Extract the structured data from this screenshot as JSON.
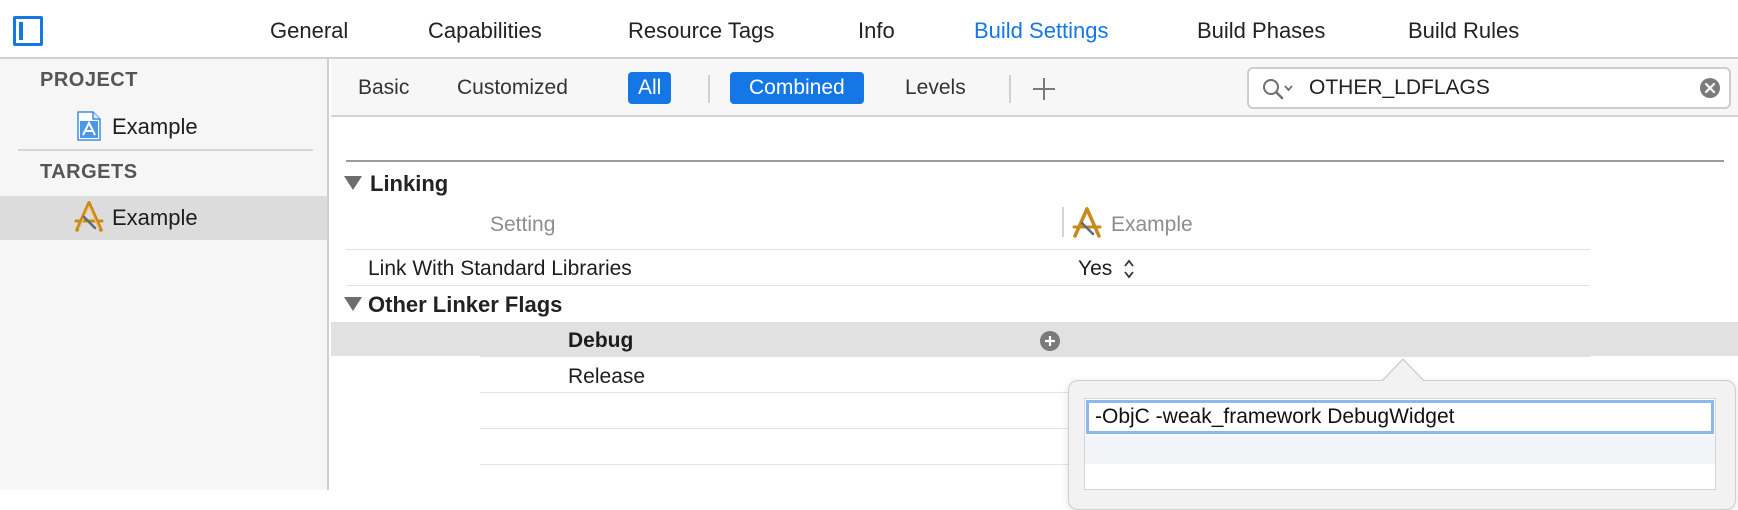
{
  "top_tabs": {
    "sidebar_toggle_icon": "sidebar-toggle-icon",
    "items": [
      {
        "label": "General"
      },
      {
        "label": "Capabilities"
      },
      {
        "label": "Resource Tags"
      },
      {
        "label": "Info"
      },
      {
        "label": "Build Settings",
        "active": true
      },
      {
        "label": "Build Phases"
      },
      {
        "label": "Build Rules"
      }
    ]
  },
  "navigator": {
    "project_header": "PROJECT",
    "project_item": "Example",
    "targets_header": "TARGETS",
    "target_item": "Example",
    "target_selected": true
  },
  "filter_bar": {
    "scope": [
      {
        "label": "Basic"
      },
      {
        "label": "Customized"
      },
      {
        "label": "All",
        "selected": true
      }
    ],
    "view": [
      {
        "label": "Combined",
        "selected": true
      },
      {
        "label": "Levels"
      }
    ],
    "add_icon": "plus-icon",
    "search": {
      "value": "OTHER_LDFLAGS",
      "icon": "search-icon",
      "clear_icon": "clear-icon"
    }
  },
  "settings": {
    "group_linking": "Linking",
    "column_setting": "Setting",
    "column_target": "Example",
    "rows": [
      {
        "name": "Link With Standard Libraries",
        "value": "Yes"
      }
    ],
    "group_other_linker_flags": "Other Linker Flags",
    "configs": [
      {
        "name": "Debug",
        "selected": true
      },
      {
        "name": "Release"
      }
    ]
  },
  "popover": {
    "value": "-ObjC -weak_framework DebugWidget"
  },
  "colors": {
    "accent": "#1577e6",
    "selection_gray": "#e1e1e1",
    "sidebar_bg": "#f6f6f6"
  }
}
